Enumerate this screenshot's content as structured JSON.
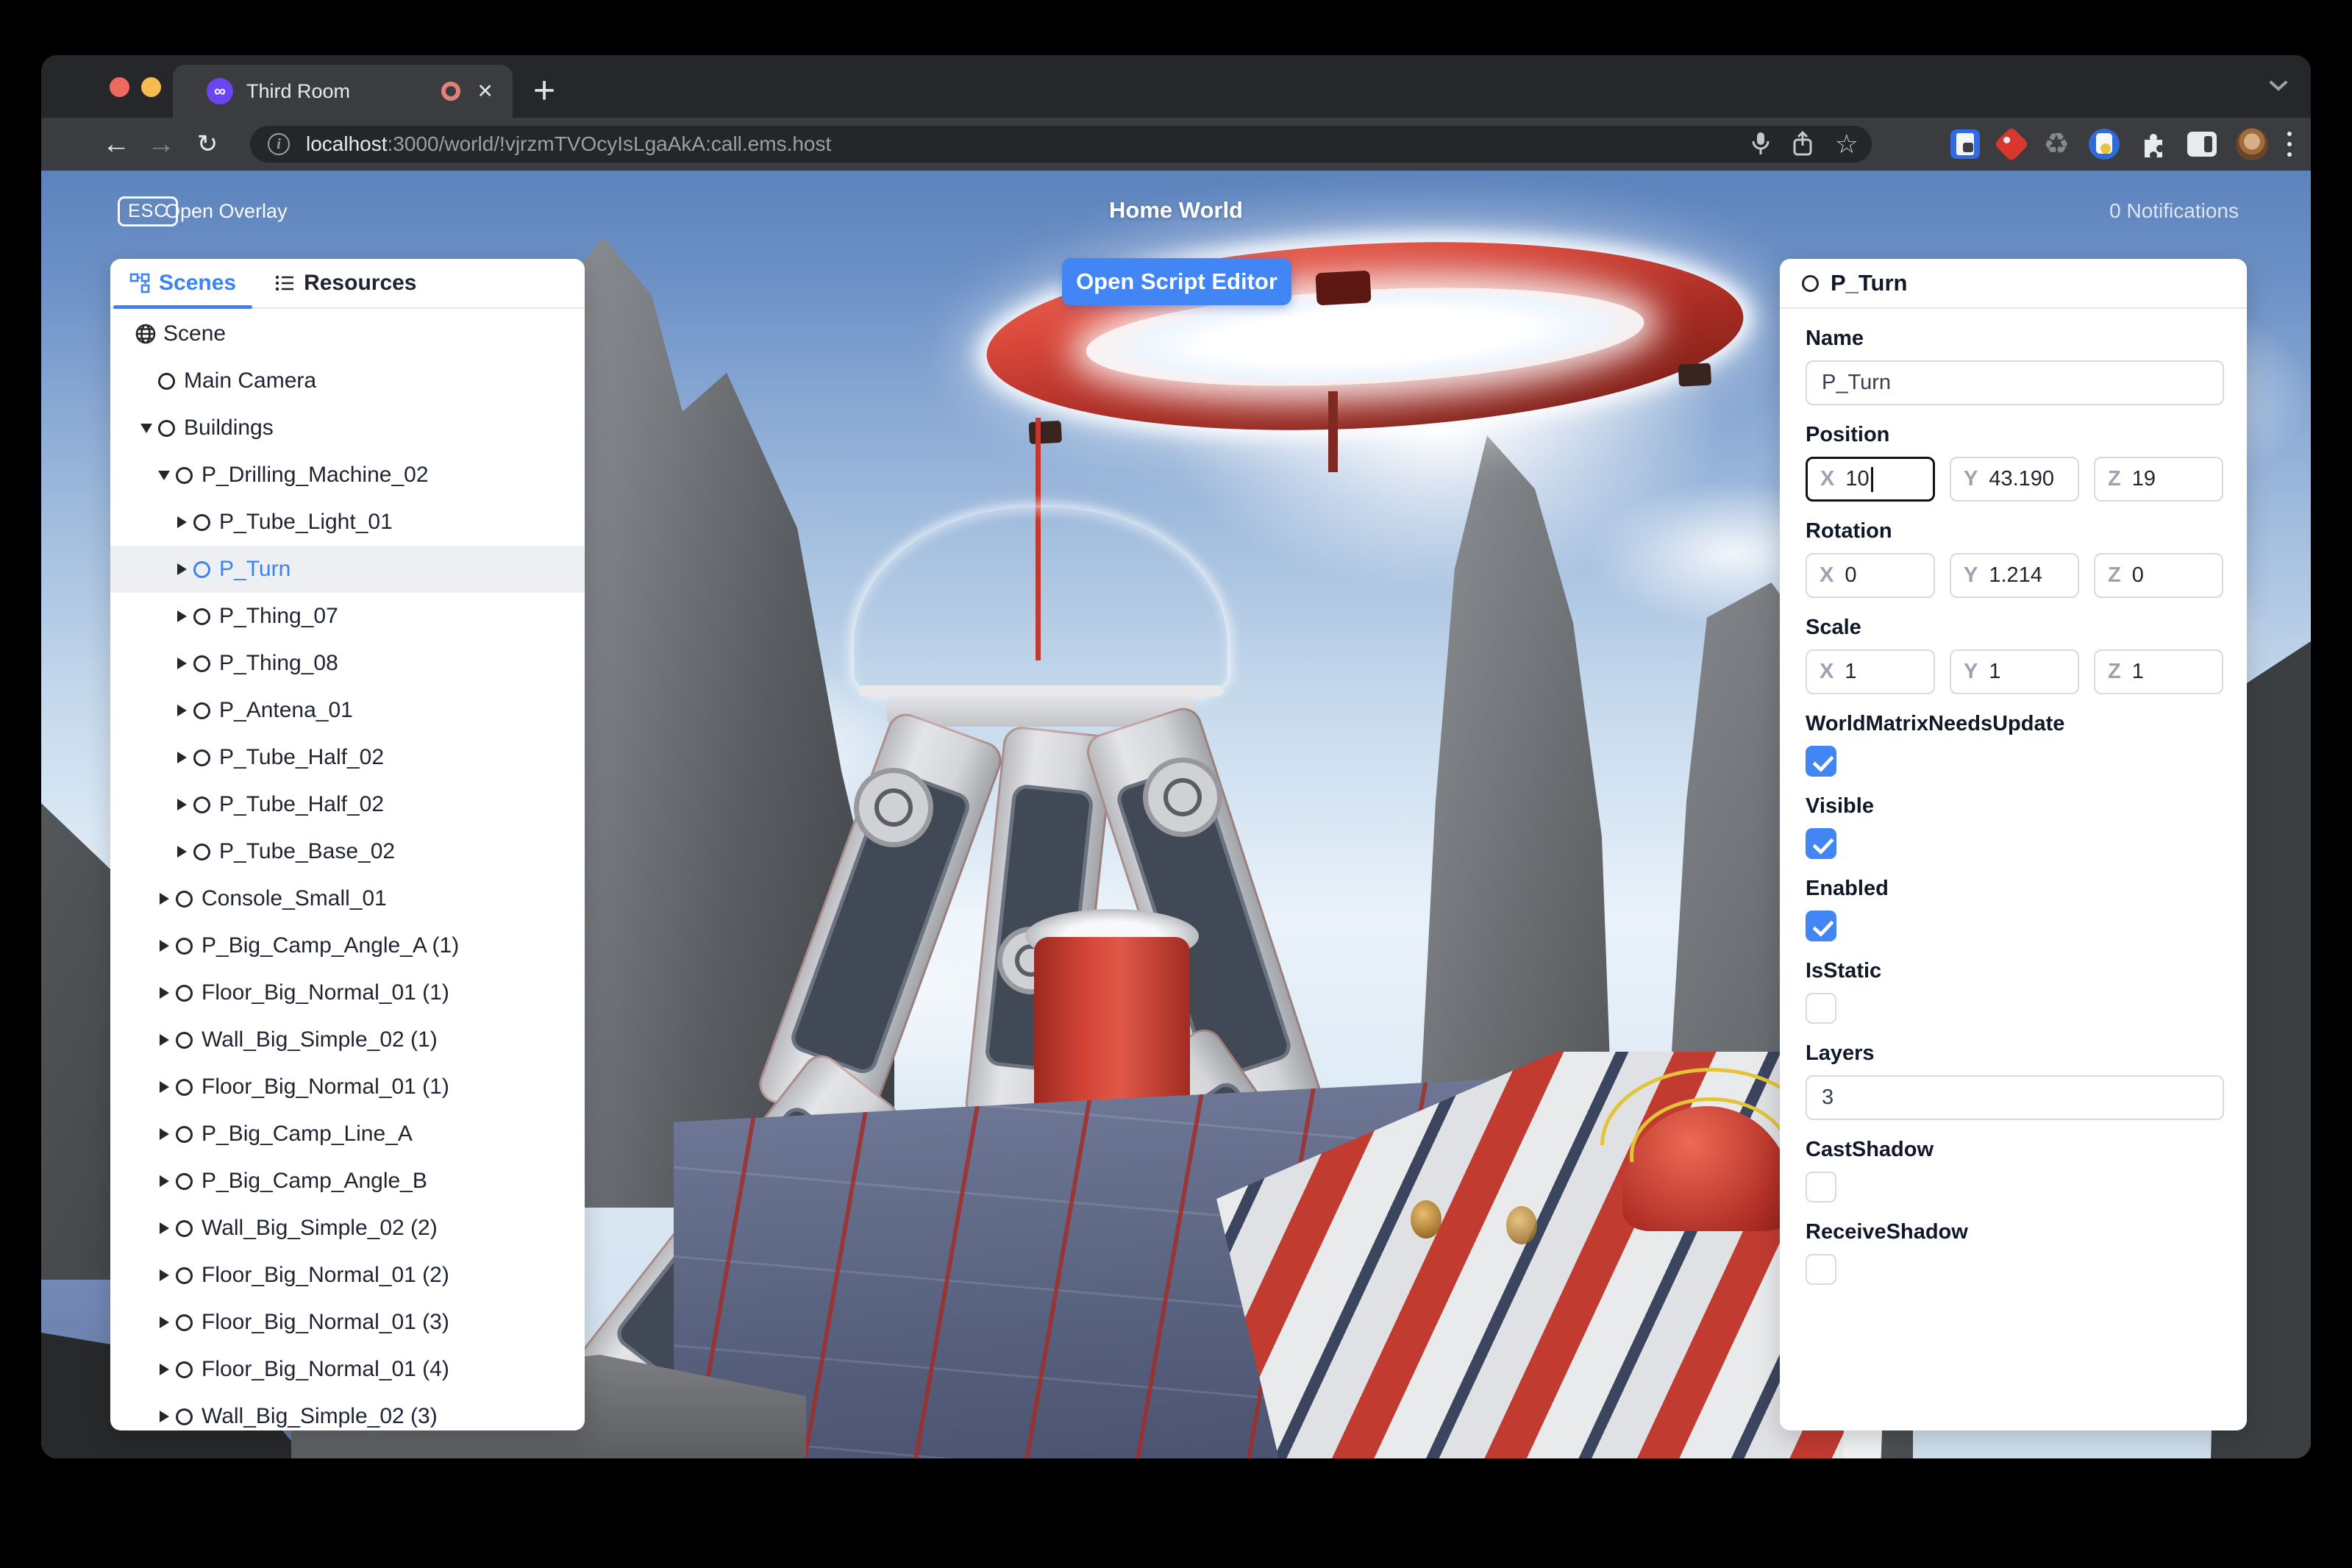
{
  "browser": {
    "tab_title": "Third Room",
    "new_tab_label": "+",
    "url": {
      "host": "localhost",
      "rest": ":3000/world/!vjrzmTVOcyIsLgaAkA:call.ems.host"
    },
    "icons": [
      "back",
      "forward",
      "reload",
      "page-info",
      "microphone",
      "share",
      "bookmark-star",
      "password-manager",
      "extension-red-diamond",
      "extension-recycle",
      "extension-blue-app",
      "extensions-puzzle",
      "sidebar-toggle",
      "profile-avatar",
      "menu-kebab"
    ]
  },
  "header": {
    "esc_key": "ESC",
    "open_overlay": "Open Overlay",
    "world_title": "Home World",
    "notifications": "0 Notifications"
  },
  "script_editor_button": "Open Script Editor",
  "left_panel": {
    "tabs": [
      {
        "label": "Scenes",
        "active": true
      },
      {
        "label": "Resources",
        "active": false
      }
    ],
    "tree": [
      {
        "label": "Scene",
        "level": 0,
        "icon": "globe",
        "expander": "none"
      },
      {
        "label": "Main Camera",
        "level": 1,
        "icon": "circle",
        "expander": "none"
      },
      {
        "label": "Buildings",
        "level": 1,
        "icon": "circle",
        "expander": "open"
      },
      {
        "label": "P_Drilling_Machine_02",
        "level": 2,
        "icon": "circle",
        "expander": "open"
      },
      {
        "label": "P_Tube_Light_01",
        "level": 3,
        "icon": "circle",
        "expander": "closed"
      },
      {
        "label": "P_Turn",
        "level": 3,
        "icon": "circle",
        "expander": "closed",
        "selected": true
      },
      {
        "label": "P_Thing_07",
        "level": 3,
        "icon": "circle",
        "expander": "closed"
      },
      {
        "label": "P_Thing_08",
        "level": 3,
        "icon": "circle",
        "expander": "closed"
      },
      {
        "label": "P_Antena_01",
        "level": 3,
        "icon": "circle",
        "expander": "closed"
      },
      {
        "label": "P_Tube_Half_02",
        "level": 3,
        "icon": "circle",
        "expander": "closed"
      },
      {
        "label": "P_Tube_Half_02",
        "level": 3,
        "icon": "circle",
        "expander": "closed"
      },
      {
        "label": "P_Tube_Base_02",
        "level": 3,
        "icon": "circle",
        "expander": "closed"
      },
      {
        "label": "Console_Small_01",
        "level": 2,
        "icon": "circle",
        "expander": "closed"
      },
      {
        "label": "P_Big_Camp_Angle_A (1)",
        "level": 2,
        "icon": "circle",
        "expander": "closed"
      },
      {
        "label": "Floor_Big_Normal_01 (1)",
        "level": 2,
        "icon": "circle",
        "expander": "closed"
      },
      {
        "label": "Wall_Big_Simple_02 (1)",
        "level": 2,
        "icon": "circle",
        "expander": "closed"
      },
      {
        "label": "Floor_Big_Normal_01 (1)",
        "level": 2,
        "icon": "circle",
        "expander": "closed"
      },
      {
        "label": "P_Big_Camp_Line_A",
        "level": 2,
        "icon": "circle",
        "expander": "closed"
      },
      {
        "label": "P_Big_Camp_Angle_B",
        "level": 2,
        "icon": "circle",
        "expander": "closed"
      },
      {
        "label": "Wall_Big_Simple_02 (2)",
        "level": 2,
        "icon": "circle",
        "expander": "closed"
      },
      {
        "label": "Floor_Big_Normal_01 (2)",
        "level": 2,
        "icon": "circle",
        "expander": "closed"
      },
      {
        "label": "Floor_Big_Normal_01 (3)",
        "level": 2,
        "icon": "circle",
        "expander": "closed"
      },
      {
        "label": "Floor_Big_Normal_01 (4)",
        "level": 2,
        "icon": "circle",
        "expander": "closed"
      },
      {
        "label": "Wall_Big_Simple_02 (3)",
        "level": 2,
        "icon": "circle",
        "expander": "closed"
      }
    ]
  },
  "properties_panel": {
    "title": "P_Turn",
    "axis_labels": {
      "x": "X",
      "y": "Y",
      "z": "Z"
    },
    "fields": {
      "name": {
        "label": "Name",
        "value": "P_Turn"
      },
      "position": {
        "label": "Position",
        "x": "10",
        "y": "43.190",
        "z": "19",
        "focused_axis": "x"
      },
      "rotation": {
        "label": "Rotation",
        "x": "0",
        "y": "1.214",
        "z": "0"
      },
      "scale": {
        "label": "Scale",
        "x": "1",
        "y": "1",
        "z": "1"
      },
      "world_matrix": {
        "label": "WorldMatrixNeedsUpdate",
        "checked": true
      },
      "visible": {
        "label": "Visible",
        "checked": true
      },
      "enabled": {
        "label": "Enabled",
        "checked": true
      },
      "is_static": {
        "label": "IsStatic",
        "checked": false
      },
      "layers": {
        "label": "Layers",
        "value": "3"
      },
      "cast_shadow": {
        "label": "CastShadow",
        "checked": false
      },
      "receive_shadow": {
        "label": "ReceiveShadow",
        "checked": false
      }
    }
  },
  "colors": {
    "accent_blue": "#3b82f6",
    "checkbox_blue": "#4285f4",
    "selected_row_bg": "#edeff3",
    "chrome_frame": "#26272a",
    "chrome_toolbar": "#3a3c40",
    "chrome_omnibox": "#242629",
    "machine_red": "#c23b31"
  }
}
